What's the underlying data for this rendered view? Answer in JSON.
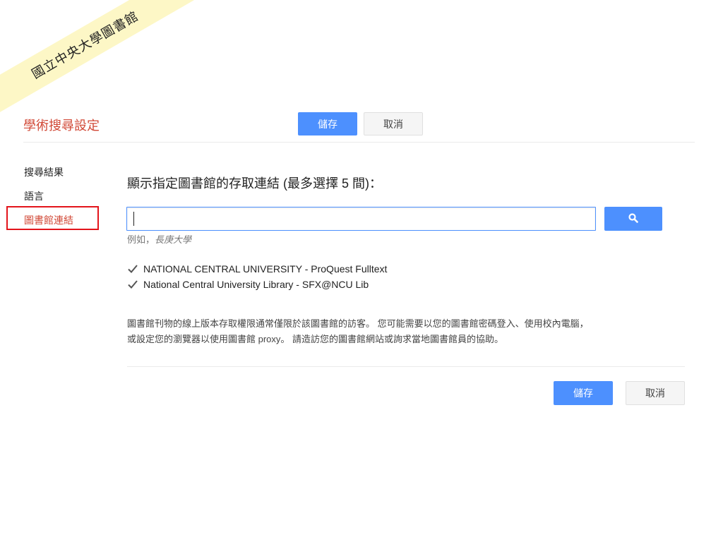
{
  "watermark": {
    "text": "國立中央大學圖書館"
  },
  "header": {
    "title": "學術搜尋設定",
    "save_label": "儲存",
    "cancel_label": "取消"
  },
  "sidebar": {
    "items": [
      {
        "label": "搜尋結果",
        "selected": false
      },
      {
        "label": "語言",
        "selected": false
      },
      {
        "label": "圖書館連結",
        "selected": true
      }
    ]
  },
  "main": {
    "heading": "顯示指定圖書館的存取連結 (最多選擇 5 間)：",
    "search": {
      "value": "",
      "placeholder": "",
      "button_icon": "search-icon"
    },
    "hint_prefix": "例如，",
    "hint_example": "長庚大學",
    "libraries": [
      {
        "name": "NATIONAL CENTRAL UNIVERSITY - ProQuest Fulltext",
        "checked": true
      },
      {
        "name": "National Central University Library - SFX@NCU Lib",
        "checked": true
      }
    ],
    "note_line1": "圖書館刊物的線上版本存取權限通常僅限於該圖書館的訪客。 您可能需要以您的圖書館密碼登入、使用校內電腦，",
    "note_line2": "或設定您的瀏覽器以使用圖書館 proxy。 請造訪您的圖書館網站或詢求當地圖書館員的協助。"
  },
  "footer": {
    "save_label": "儲存",
    "cancel_label": "取消"
  },
  "colors": {
    "primary_button": "#4d90fe",
    "accent_red": "#d14836",
    "highlight_box": "#e3141b",
    "ribbon": "#fdf7c6"
  }
}
